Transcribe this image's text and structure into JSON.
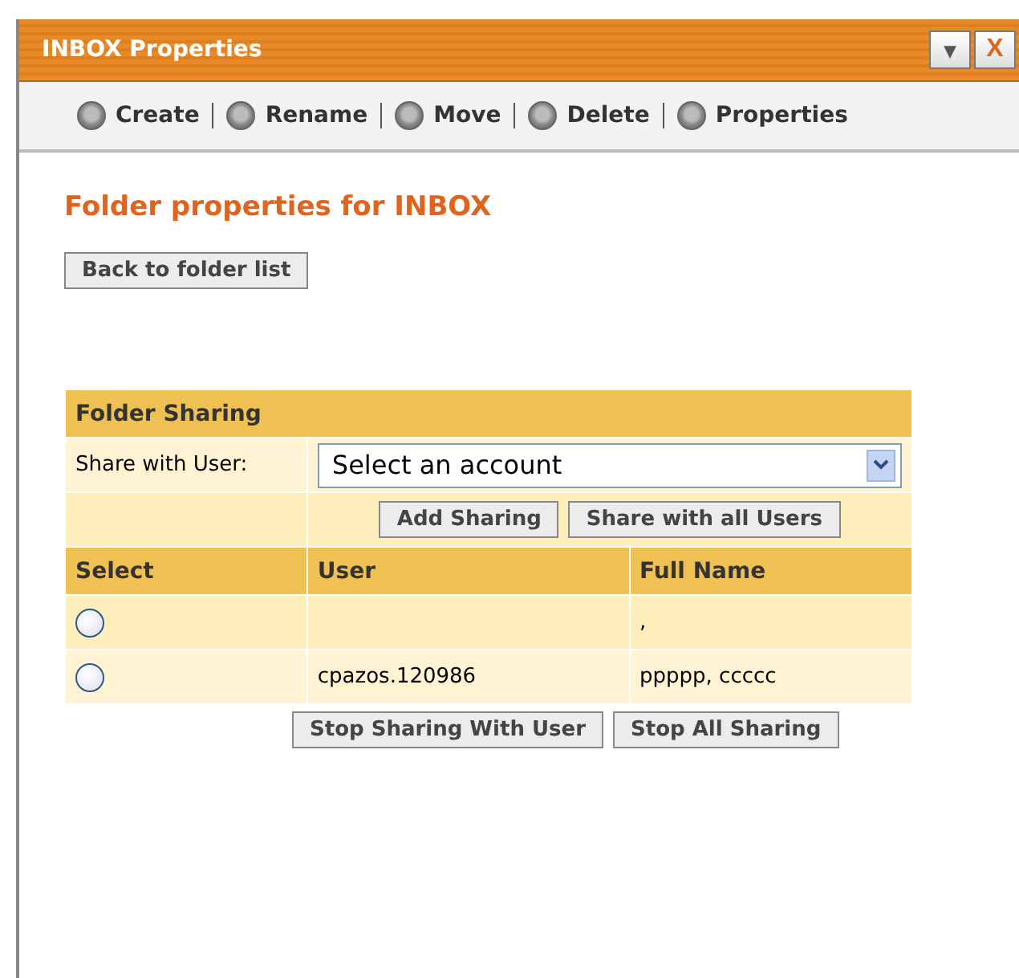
{
  "window": {
    "title": "INBOX Properties",
    "controls": [
      "▾",
      "X"
    ]
  },
  "toolbar": [
    {
      "label": "Create"
    },
    {
      "label": "Rename"
    },
    {
      "label": "Move"
    },
    {
      "label": "Delete"
    },
    {
      "label": "Properties"
    }
  ],
  "heading": "Folder properties for INBOX",
  "back_button": "Back to folder list",
  "sharing": {
    "title": "Folder Sharing",
    "share_label": "Share with User:",
    "account_select": "Select an account",
    "buttons": [
      "Add Sharing",
      "Share with all Users"
    ],
    "columns": [
      "Select",
      "User",
      "Full Name"
    ],
    "rows": [
      {
        "selected": false,
        "user": "",
        "full_name": ","
      },
      {
        "selected": false,
        "user": "cpazos.120986",
        "full_name": "ppppp, ccccc"
      }
    ],
    "footer_buttons": [
      "Stop Sharing With User",
      "Stop All Sharing"
    ]
  }
}
